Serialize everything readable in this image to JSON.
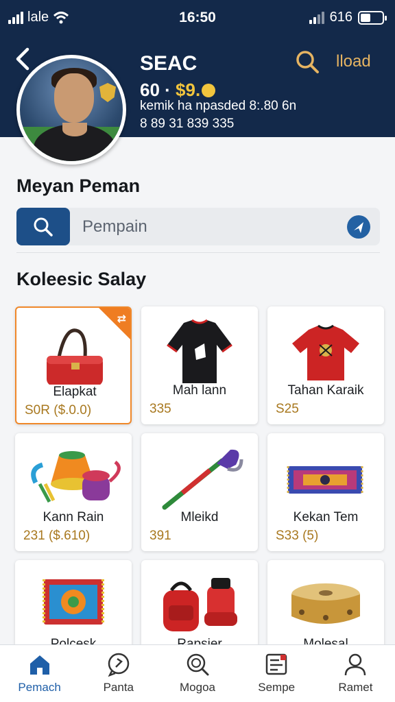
{
  "status": {
    "carrier": "lale",
    "time": "16:50",
    "right_text": "616"
  },
  "header": {
    "player_name": "SEAC",
    "stat_prefix": "60 ·",
    "stat_value": "$9.",
    "info": "kemik ha npasded 8:.80 6n",
    "id": "8 89 31 839 335",
    "load_label": "lload"
  },
  "section1": {
    "title": "Meyan Peman"
  },
  "search": {
    "placeholder": "Pempain"
  },
  "section2": {
    "title": "Koleesic Salay"
  },
  "items": [
    {
      "name": "Elapkat",
      "price": "S0R  ($.0.0)",
      "icon": "red-handbag"
    },
    {
      "name": "Mah lann",
      "price": "335",
      "icon": "black-jersey"
    },
    {
      "name": "Tahan Karaik",
      "price": "S25",
      "icon": "red-jersey"
    },
    {
      "name": "Kann Rain",
      "price": "231  ($.610)",
      "icon": "colorful-drum"
    },
    {
      "name": "Mleikd",
      "price": "391",
      "icon": "hockey-stick"
    },
    {
      "name": "Kekan Tem",
      "price": "S33  (5)",
      "icon": "woven-rug"
    },
    {
      "name": "Polcesk",
      "price": "",
      "icon": "patterned-rug"
    },
    {
      "name": "Rapsier",
      "price": "",
      "icon": "red-backpack"
    },
    {
      "name": "Molesal",
      "price": "",
      "icon": "gold-drum"
    }
  ],
  "nav": [
    {
      "label": "Pemach",
      "icon": "home-icon",
      "active": true
    },
    {
      "label": "Panta",
      "icon": "chat-icon"
    },
    {
      "label": "Mogoa",
      "icon": "search-icon"
    },
    {
      "label": "Sempe",
      "icon": "list-icon"
    },
    {
      "label": "Ramet",
      "icon": "profile-icon"
    }
  ],
  "colors": {
    "header": "#13294a",
    "accent": "#1d4f88",
    "highlight": "#ef7d22",
    "price": "#a8781f"
  }
}
